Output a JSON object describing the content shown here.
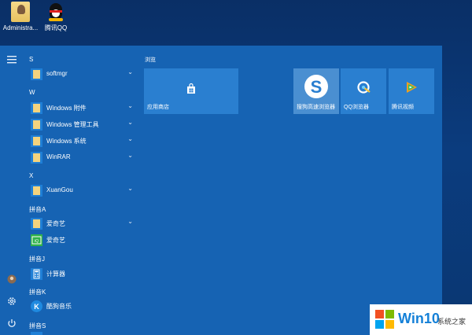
{
  "desktop": {
    "icons": [
      {
        "label": "Administra..."
      },
      {
        "label": "腾讯QQ"
      }
    ]
  },
  "rail": {
    "menu_icon": "hamburger-icon",
    "user_icon": "avatar-icon",
    "settings_icon": "gear-icon",
    "power_icon": "power-icon"
  },
  "apps": {
    "sections": [
      {
        "letter": "S"
      },
      {
        "letter": "W"
      },
      {
        "letter": "X"
      },
      {
        "letter": "拼音A"
      },
      {
        "letter": "拼音J"
      },
      {
        "letter": "拼音K"
      },
      {
        "letter": "拼音S"
      }
    ],
    "items": [
      {
        "label": "softmgr"
      },
      {
        "label": "Windows 附件"
      },
      {
        "label": "Windows 管理工具"
      },
      {
        "label": "Windows 系统"
      },
      {
        "label": "WinRAR"
      },
      {
        "label": "XuanGou"
      },
      {
        "label": "爱奇艺"
      },
      {
        "label": "爱奇艺"
      },
      {
        "label": "计算器"
      },
      {
        "label": "酷狗音乐"
      }
    ],
    "expand_chevron": "⌄"
  },
  "tiles": {
    "group_label": "浏览",
    "items": [
      {
        "label": "应用商店"
      },
      {
        "label": "搜狗高速浏览器"
      },
      {
        "label": "QQ浏览器"
      },
      {
        "label": "腾讯视频"
      }
    ]
  },
  "watermark": {
    "brand": "Win10",
    "site": "系统之家"
  },
  "colors": {
    "start_menu_bg": "#1663b3",
    "tile_bg": "#2a7fd0",
    "desktop_bg": "#0b3c7e"
  }
}
